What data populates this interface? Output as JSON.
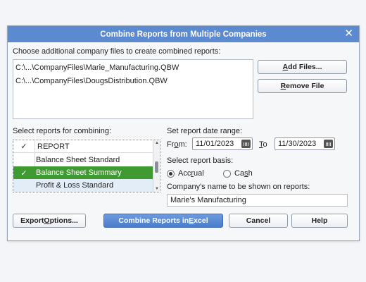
{
  "dialog": {
    "title": "Combine Reports from Multiple Companies",
    "close_glyph": "✕"
  },
  "files": {
    "label": "Choose additional company files to create combined reports:",
    "items": [
      "C:\\...\\CompanyFiles\\Marie_Manufacturing.QBW",
      "C:\\...\\CompanyFiles\\DougsDistribution.QBW"
    ],
    "add_button_mnemonic": "A",
    "add_button_rest": "dd Files...",
    "remove_button_mnemonic": "R",
    "remove_button_rest": "emove File"
  },
  "reports": {
    "label": "Select reports for combining:",
    "header_check": "✓",
    "header_label": "REPORT",
    "rows": [
      {
        "label": "Balance Sheet Standard",
        "check": ""
      },
      {
        "label": "Balance Sheet Summary",
        "check": "✓"
      },
      {
        "label": "Profit & Loss Standard",
        "check": ""
      }
    ]
  },
  "date_range": {
    "label": "Set report date range:",
    "from_pre": "Fr",
    "from_mnemonic": "o",
    "from_post": "m:",
    "from_value": "11/01/2023",
    "to_mnemonic": "T",
    "to_post": "o",
    "to_value": "11/30/2023"
  },
  "basis": {
    "label": "Select report basis:",
    "accrual_pre": "Acc",
    "accrual_mnemonic": "r",
    "accrual_post": "ual",
    "cash_pre": "Ca",
    "cash_mnemonic": "s",
    "cash_post": "h",
    "selected": "Accrual"
  },
  "company_name": {
    "label": "Company's name to be shown on reports:",
    "value": "Marie's Manufacturing"
  },
  "buttons": {
    "export_pre": "Export ",
    "export_mnemonic": "O",
    "export_post": "ptions...",
    "combine_pre": "Combine Reports in ",
    "combine_mnemonic": "E",
    "combine_post": "xcel",
    "cancel": "Cancel",
    "help": "Help"
  },
  "colors": {
    "titlebar": "#5b8ad0",
    "selected_row": "#3f9b31",
    "primary_button": "#4a7cc9"
  }
}
